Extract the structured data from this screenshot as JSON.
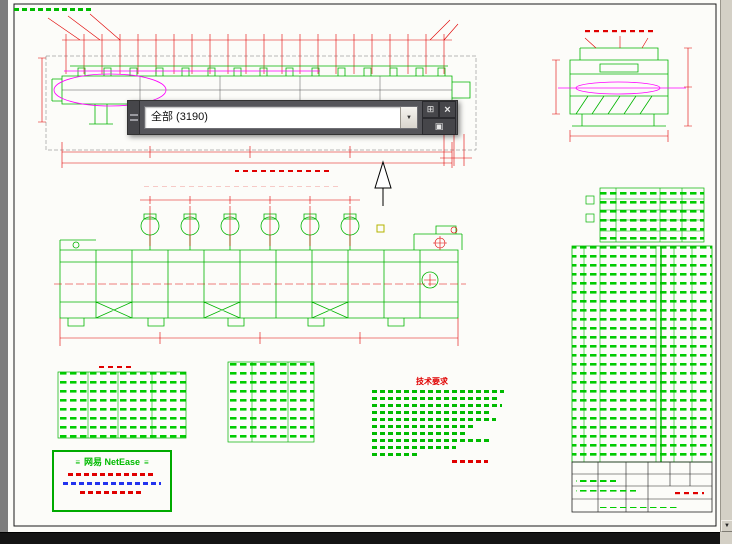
{
  "palette": {
    "object_filter_value": "全部 (3190)",
    "icons": {
      "dropdown_arrow": "▼",
      "close": "×",
      "pickadd": "⊞",
      "quick_select": "▣"
    }
  },
  "drawing": {
    "notes_title": "技术要求"
  },
  "watermark": {
    "brand": "网易 NetEase",
    "decor": "≡"
  },
  "scrollbar": {
    "down_arrow": "▼"
  },
  "colors": {
    "geometry_green": "#00b400",
    "dimension_red": "#e00000",
    "highlight_magenta": "#ff00ff",
    "table_text_green": "#00cc00",
    "link_blue": "#2233ee",
    "sheet": "#fcfcf9",
    "app_background": "#7d7d7d",
    "palette_background": "#55555a",
    "bottom_bar": "#141414"
  }
}
